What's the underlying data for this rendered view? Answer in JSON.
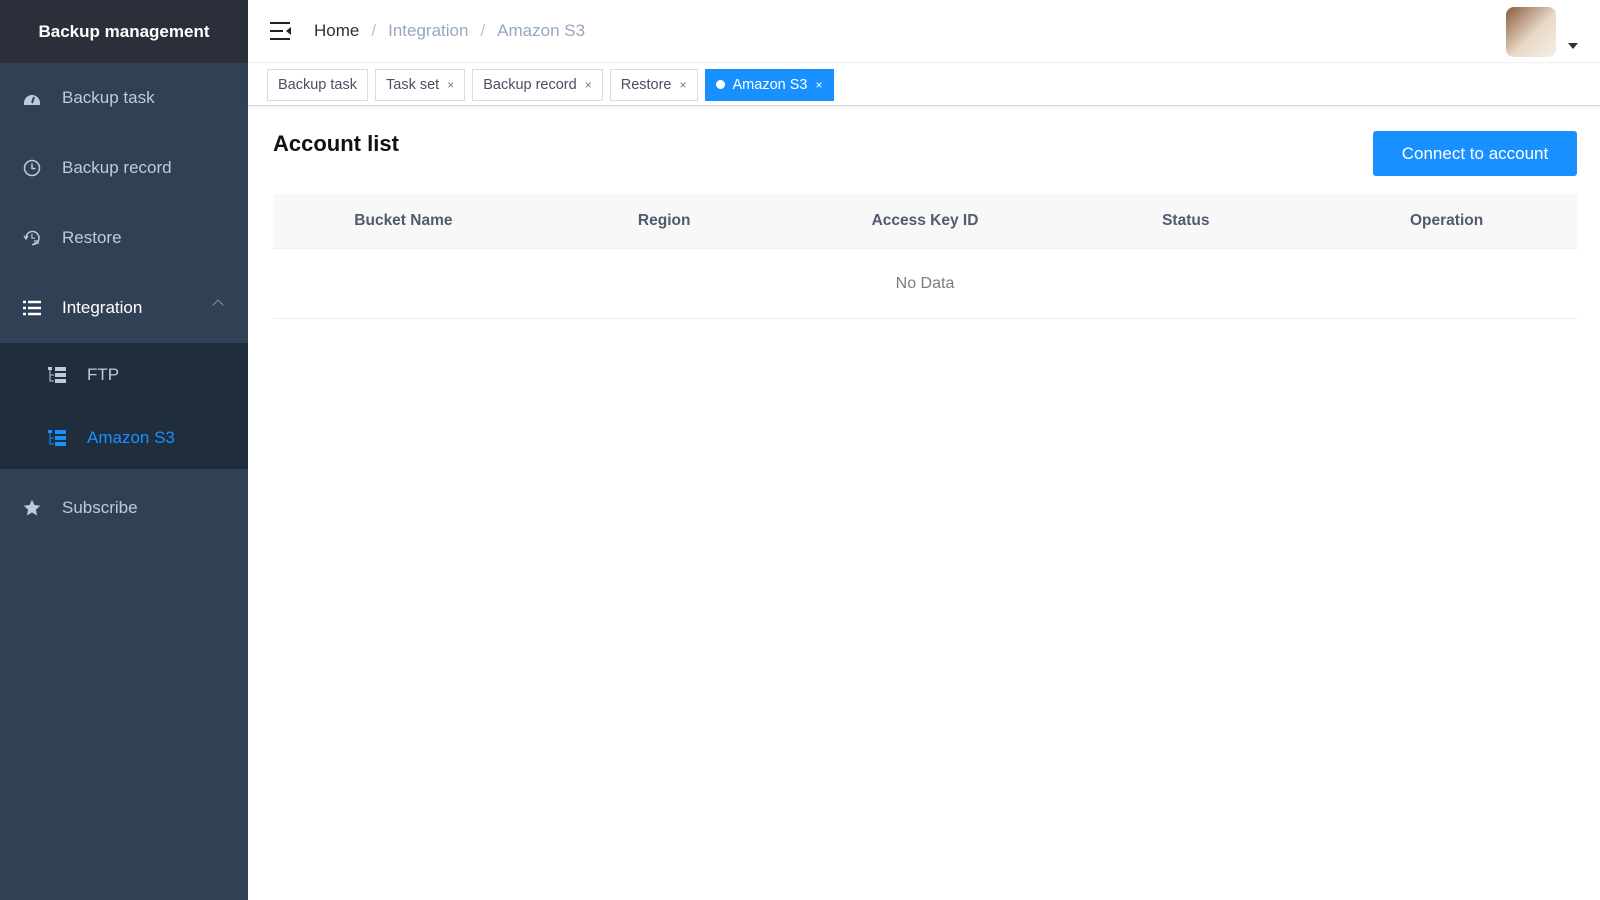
{
  "sidebar": {
    "title": "Backup management",
    "items": [
      {
        "label": "Backup task",
        "icon": "dashboard-icon"
      },
      {
        "label": "Backup record",
        "icon": "clock-icon"
      },
      {
        "label": "Restore",
        "icon": "history-icon"
      },
      {
        "label": "Integration",
        "icon": "list-icon"
      },
      {
        "label": "FTP",
        "icon": "tree-table-icon"
      },
      {
        "label": "Amazon S3",
        "icon": "tree-table-icon"
      },
      {
        "label": "Subscribe",
        "icon": "star-icon"
      }
    ]
  },
  "header": {
    "breadcrumb": [
      "Home",
      "Integration",
      "Amazon S3"
    ]
  },
  "tags": [
    {
      "label": "Backup task"
    },
    {
      "label": "Task set"
    },
    {
      "label": "Backup record"
    },
    {
      "label": "Restore"
    },
    {
      "label": "Amazon S3"
    }
  ],
  "close_glyph": "×",
  "main": {
    "title": "Account list",
    "connect_label": "Connect to account",
    "columns": [
      "Bucket Name",
      "Region",
      "Access Key ID",
      "Status",
      "Operation"
    ],
    "empty_text": "No Data"
  },
  "colors": {
    "accent": "#1890ff",
    "sidebar": "#304156"
  }
}
